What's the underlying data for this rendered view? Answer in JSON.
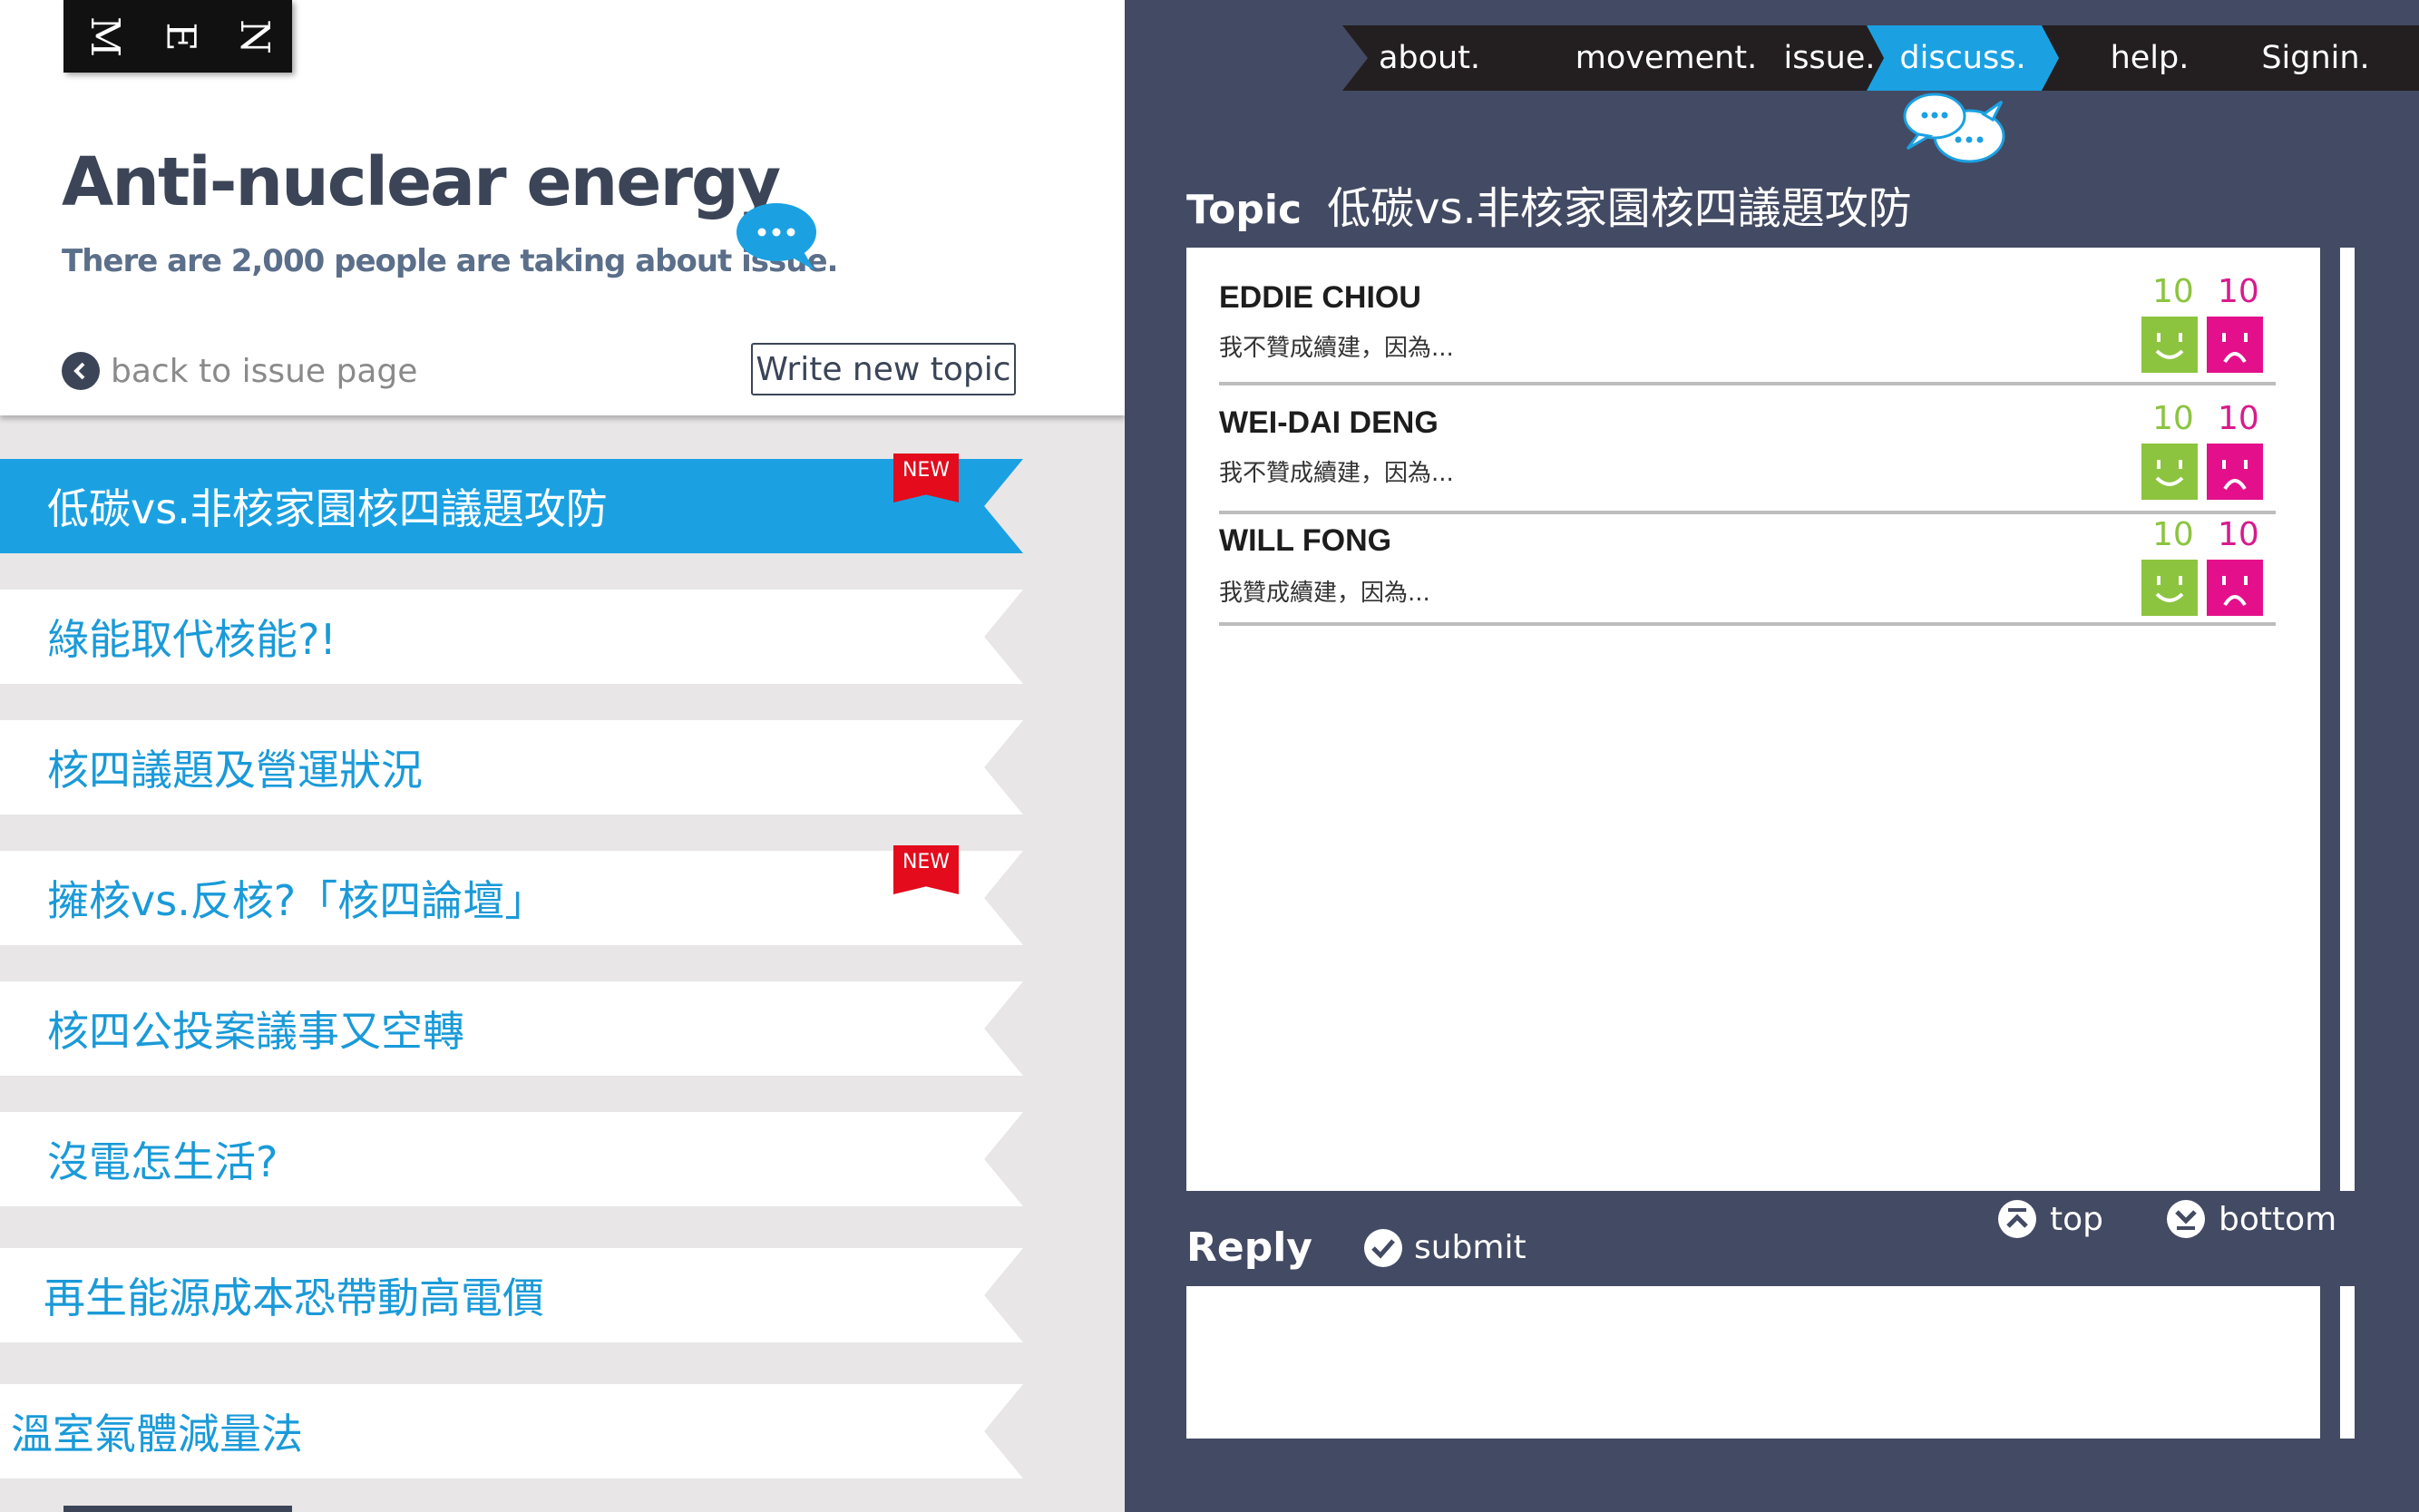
{
  "menu": {
    "letters": [
      "M",
      "E",
      "N"
    ]
  },
  "issue": {
    "title": "Anti-nuclear energy",
    "subtitle": "There are 2,000 people are taking about issue.",
    "back_label": "back to issue page",
    "write_label": "Write new topic"
  },
  "topics": [
    {
      "label": "低碳vs.非核家園核四議題攻防",
      "new": "NEW",
      "active": true
    },
    {
      "label": "綠能取代核能?!"
    },
    {
      "label": "核四議題及營運狀況"
    },
    {
      "label": "擁核vs.反核?「核四論壇」",
      "new": "NEW"
    },
    {
      "label": "核四公投案議事又空轉"
    },
    {
      "label": "沒電怎生活?"
    },
    {
      "label": "再生能源成本恐帶動高電價"
    },
    {
      "label": "溫室氣體減量法"
    }
  ],
  "nav": [
    {
      "label": "about."
    },
    {
      "label": "movement."
    },
    {
      "label": "issue."
    },
    {
      "label": "discuss.",
      "active": true
    },
    {
      "label": "help."
    },
    {
      "label": "Signin."
    }
  ],
  "topic": {
    "label": "Topic",
    "title": "低碳vs.非核家園核四議題攻防"
  },
  "posts": [
    {
      "name": "EDDIE CHIOU",
      "text": "我不贊成續建，因為...",
      "up": "10",
      "down": "10"
    },
    {
      "name": "WEI-DAI DENG",
      "text": "我不贊成續建，因為...",
      "up": "10",
      "down": "10"
    },
    {
      "name": "WILL FONG",
      "text": "我贊成續建，因為...",
      "up": "10",
      "down": "10"
    }
  ],
  "reply": {
    "label": "Reply",
    "submit_label": "submit",
    "top_label": "top",
    "bottom_label": "bottom",
    "value": ""
  },
  "colors": {
    "accent": "#1ba1e2",
    "dark": "#434a63",
    "like": "#8cc43f",
    "dislike": "#e4108b",
    "new_tag": "#e30b1c"
  },
  "icons": {
    "back": "chevron-left-circle-icon",
    "bubble": "chat-bubble-icon",
    "like": "smile-face-icon",
    "dislike": "frown-face-icon",
    "submit": "check-circle-icon",
    "top": "arrow-up-circle-icon",
    "bottom": "arrow-down-circle-icon"
  }
}
